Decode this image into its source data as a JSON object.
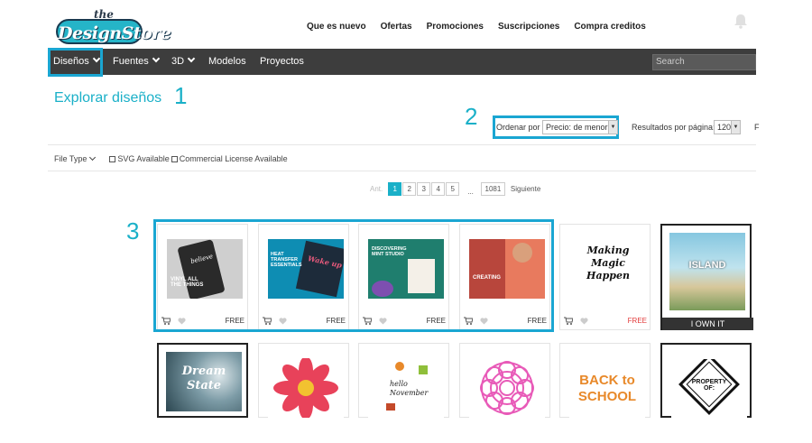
{
  "header": {
    "logo_top": "the",
    "logo_main": "DesignStore",
    "nav": [
      "Que es nuevo",
      "Ofertas",
      "Promociones",
      "Suscripciones",
      "Compra creditos"
    ]
  },
  "navbar": {
    "items": [
      "Diseños",
      "Fuentes",
      "3D",
      "Modelos",
      "Proyectos"
    ],
    "search_placeholder": "Search"
  },
  "page": {
    "title": "Explorar diseños"
  },
  "annotations": [
    "1",
    "2",
    "3"
  ],
  "sort": {
    "label": "Ordenar por",
    "value": "Precio: de menor a",
    "results_label": "Resultados por página:",
    "results_value": "120",
    "results_extra": "F"
  },
  "filters": {
    "file_type": "File Type",
    "svg": "SVG Available",
    "license": "Commercial License Available"
  },
  "pager": {
    "prev": "Ant.",
    "pages": [
      "1",
      "2",
      "3",
      "4",
      "5"
    ],
    "ellipsis": "...",
    "last": "1081",
    "next": "Siguiente"
  },
  "products_row1": [
    {
      "thumb_text": "VINYL ALL THE THINGS",
      "price": "FREE"
    },
    {
      "thumb_text": "HEAT TRANSFER ESSENTIALS",
      "price": "FREE"
    },
    {
      "thumb_text": "DISCOVERING MINT STUDIO",
      "price": "FREE"
    },
    {
      "thumb_text": "CREATING",
      "price": "FREE"
    },
    {
      "thumb_text": "Making Magic Happen",
      "price": "FREE"
    },
    {
      "thumb_text": "ISLAND",
      "price": "I OWN IT"
    }
  ],
  "products_row2": [
    {
      "thumb_text": "Dream State"
    },
    {
      "thumb_text": ""
    },
    {
      "thumb_text": "hello November"
    },
    {
      "thumb_text": ""
    },
    {
      "thumb_text": "BACK to SCHOOL"
    },
    {
      "thumb_text": "PROPERTY OF:"
    }
  ],
  "colors": {
    "accent": "#1ab0c8",
    "nav": "#3d3d3d",
    "highlight": "#1aa6d2",
    "free_red": "#e23b3b"
  }
}
